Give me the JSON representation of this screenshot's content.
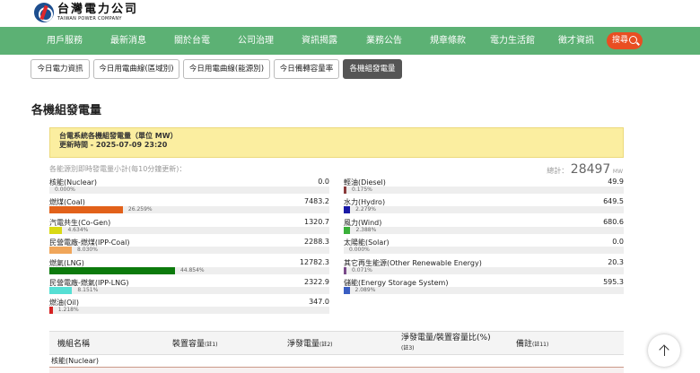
{
  "logo": {
    "cn": "台灣電力公司",
    "en": "TAIWAN POWER COMPANY"
  },
  "nav": [
    "用戶服務",
    "最新消息",
    "關於台電",
    "公司治理",
    "資訊揭露",
    "業務公告",
    "規章條款",
    "電力生活館",
    "徵才資訊"
  ],
  "search_label": "搜尋",
  "tabs": [
    "今日電力資訊",
    "今日用電曲線(區域別)",
    "今日用電曲線(能源別)",
    "今日備轉容量率",
    "各機組發電量"
  ],
  "page_title": "各機組發電量",
  "notice": {
    "line1": "台電系統各機組發電量（單位 MW）",
    "line2": "更新時間 - 2025-07-09 23:20"
  },
  "subcaption": "各能源別即時發電量小計(每10分鐘更新)：",
  "total": {
    "label": "總計：",
    "value": "28497",
    "unit": "MW"
  },
  "sources_left": [
    {
      "name": "核能(Nuclear)",
      "value": "0.0",
      "pct": "0.000%",
      "fraction": 0.0,
      "color": "#999999"
    },
    {
      "name": "燃煤(Coal)",
      "value": "7483.2",
      "pct": "26.259%",
      "fraction": 0.26259,
      "color": "#e2611a"
    },
    {
      "name": "汽電共生(Co-Gen)",
      "value": "1320.7",
      "pct": "4.634%",
      "fraction": 0.04634,
      "color": "#d9d914"
    },
    {
      "name": "民營電廠-燃煤(IPP-Coal)",
      "value": "2288.3",
      "pct": "8.030%",
      "fraction": 0.0803,
      "color": "#f0a65a"
    },
    {
      "name": "燃氣(LNG)",
      "value": "12782.3",
      "pct": "44.854%",
      "fraction": 0.44854,
      "color": "#0c7a0c"
    },
    {
      "name": "民營電廠-燃氣(IPP-LNG)",
      "value": "2322.9",
      "pct": "8.151%",
      "fraction": 0.08151,
      "color": "#55dfd4"
    },
    {
      "name": "燃油(Oil)",
      "value": "347.0",
      "pct": "1.218%",
      "fraction": 0.01218,
      "color": "#d62222"
    }
  ],
  "sources_right": [
    {
      "name": "輕油(Diesel)",
      "value": "49.9",
      "pct": "0.175%",
      "fraction": 0.00175,
      "color": "#8a3a3a"
    },
    {
      "name": "水力(Hydro)",
      "value": "649.5",
      "pct": "2.279%",
      "fraction": 0.02279,
      "color": "#1a1aa6"
    },
    {
      "name": "風力(Wind)",
      "value": "680.6",
      "pct": "2.388%",
      "fraction": 0.02388,
      "color": "#3ab03a"
    },
    {
      "name": "太陽能(Solar)",
      "value": "0.0",
      "pct": "0.000%",
      "fraction": 0.0,
      "color": "#e8c21a"
    },
    {
      "name": "其它再生能源(Other Renewable Energy)",
      "value": "20.3",
      "pct": "0.071%",
      "fraction": 0.00071,
      "color": "#7a4a8a"
    },
    {
      "name": "儲能(Energy Storage System)",
      "value": "595.3",
      "pct": "2.089%",
      "fraction": 0.02089,
      "color": "#3a5ec2"
    }
  ],
  "table": {
    "headers": [
      {
        "label": "機組名稱",
        "note": ""
      },
      {
        "label": "裝置容量",
        "note": "(註1)"
      },
      {
        "label": "淨發電量",
        "note": "(註2)"
      },
      {
        "label": "淨發電量/裝置容量比(%)",
        "note": "(註3)"
      },
      {
        "label": "備註",
        "note": "(註11)"
      }
    ],
    "group": "核能(Nuclear)"
  }
}
